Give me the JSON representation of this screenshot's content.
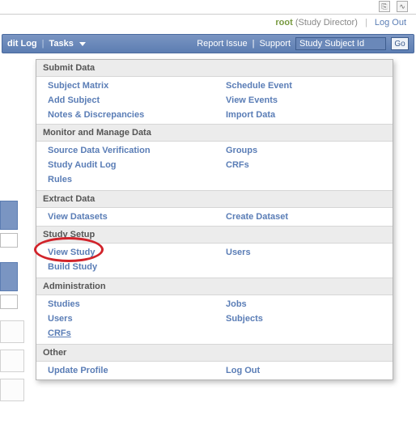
{
  "top_icons": {
    "share": "⎘",
    "rss": "∿"
  },
  "user": {
    "name": "root",
    "role": "(Study Director)",
    "logout": "Log Out"
  },
  "nav": {
    "left": [
      {
        "label": "dit Log",
        "truncated": true
      },
      {
        "label": "Tasks",
        "hasDropdown": true
      }
    ],
    "right": {
      "report_issue": "Report Issue",
      "support": "Support",
      "search_placeholder": "Study Subject Id",
      "go": "Go"
    }
  },
  "menu": [
    {
      "header": "Submit Data",
      "rows": [
        {
          "left": "Subject Matrix",
          "right": "Schedule Event"
        },
        {
          "left": "Add Subject",
          "right": "View Events"
        },
        {
          "left": "Notes & Discrepancies",
          "right": "Import Data"
        }
      ]
    },
    {
      "header": "Monitor and Manage Data",
      "rows": [
        {
          "left": "Source Data Verification",
          "right": "Groups"
        },
        {
          "left": "Study Audit Log",
          "right": "CRFs"
        },
        {
          "left": "Rules",
          "right": ""
        }
      ]
    },
    {
      "header": "Extract Data",
      "rows": [
        {
          "left": "View Datasets",
          "right": "Create Dataset"
        }
      ]
    },
    {
      "header": "Study Setup",
      "rows": [
        {
          "left": "View Study",
          "right": "Users",
          "highlight": true
        },
        {
          "left": "Build Study",
          "right": ""
        }
      ]
    },
    {
      "header": "Administration",
      "rows": [
        {
          "left": "Studies",
          "right": "Jobs"
        },
        {
          "left": "Users",
          "right": "Subjects"
        },
        {
          "left": "CRFs",
          "right": "",
          "underline_left": true
        }
      ]
    },
    {
      "header": "Other",
      "rows": [
        {
          "left": "Update Profile",
          "right": "Log Out"
        }
      ]
    }
  ]
}
